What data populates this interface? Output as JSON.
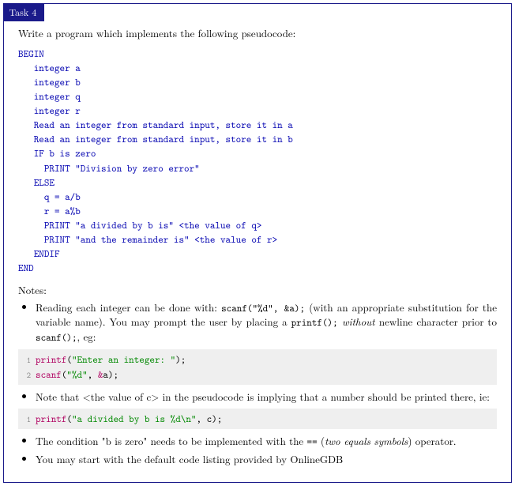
{
  "task": {
    "label": "Task 4",
    "intro": "Write a program which implements the following pseudocode:"
  },
  "pseudocode": {
    "l1": "BEGIN",
    "l2": "   integer a",
    "l3": "   integer b",
    "l4": "   integer q",
    "l5": "   integer r",
    "l6": "   Read an integer from standard input, store it in a",
    "l7": "   Read an integer from standard input, store it in b",
    "l8": "   IF b is zero",
    "l9": "     PRINT \"Division by zero error\"",
    "l10": "   ELSE",
    "l11": "     q = a/b",
    "l12": "     r = a%b",
    "l13": "     PRINT \"a divided by b is\" <the value of q>",
    "l14": "     PRINT \"and the remainder is\" <the value of r>",
    "l15": "   ENDIF",
    "l16": "END"
  },
  "notes": {
    "header": "Notes:",
    "item1": {
      "pre": "Reading each integer can be done with: ",
      "code": "scanf(\"%d\", &a);",
      "mid": " (with an appropriate substitution for the variable name). You may prompt the user by placing a ",
      "code2": "printf();",
      "without": " without ",
      "post": "newline character prior to ",
      "code3": "scanf();",
      "eg": ", eg:"
    },
    "snippet1": {
      "line1": {
        "no": "1",
        "fn": "printf",
        "open": "(",
        "str": "\"Enter an integer: \"",
        "close": ");"
      },
      "line2": {
        "no": "2",
        "fn": "scanf",
        "open": "(",
        "str": "\"%d\"",
        "sep": ", ",
        "amp": "&",
        "var": "a",
        "close": ");"
      }
    },
    "item2": {
      "pre": "Note that <the value of c> in the pseudocode is implying that a number should be printed there, ie:"
    },
    "snippet2": {
      "line1": {
        "no": "1",
        "fn": "printf",
        "open": "(",
        "str": "\"a divided by b is %d\\n\"",
        "sep": ", c",
        "close": ");"
      }
    },
    "item3": {
      "pre": "The condition \"b is zero\" needs to be implemented with the ",
      "op": "==",
      "mid": " (",
      "it": "two equals symbols",
      "post": ") operator."
    },
    "item4": "You may start with the default code listing provided by OnlineGDB"
  }
}
